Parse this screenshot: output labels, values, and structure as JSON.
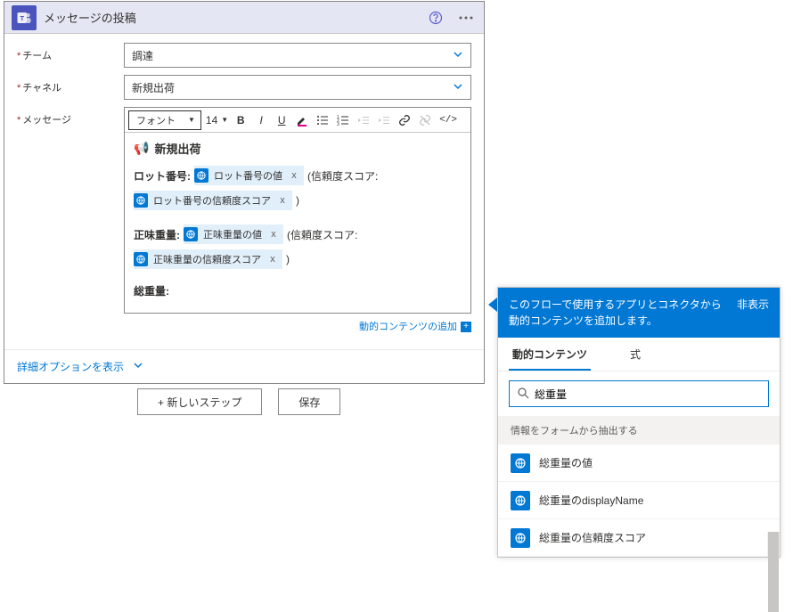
{
  "header": {
    "title": "メッセージの投稿"
  },
  "fields": {
    "team": {
      "label": "チーム",
      "value": "調達"
    },
    "channel": {
      "label": "チャネル",
      "value": "新規出荷"
    },
    "message": {
      "label": "メッセージ"
    }
  },
  "toolbar": {
    "font": "フォント",
    "size": "14"
  },
  "editor": {
    "announce_title": "新規出荷",
    "lot_label": "ロット番号:",
    "lot_token1": "ロット番号の値",
    "conf_prefix": "(信頼度スコア:",
    "lot_token2": "ロット番号の信頼度スコア",
    "close_paren": ")",
    "net_label": "正味重量:",
    "net_token1": "正味重量の値",
    "net_token2": "正味重量の信頼度スコア",
    "gross_label": "総重量:",
    "add_dynamic": "動的コンテンツの追加"
  },
  "token_x": "x",
  "advanced": "詳細オプションを表示",
  "buttons": {
    "new_step": "+ 新しいステップ",
    "save": "保存"
  },
  "flyout": {
    "desc": "このフローで使用するアプリとコネクタから動的コンテンツを追加します。",
    "hide": "非表示",
    "tab_dynamic": "動的コンテンツ",
    "tab_expr": "式",
    "search_value": "総重量",
    "group_title": "情報をフォームから抽出する",
    "items": {
      "i1": "総重量の値",
      "i2": "総重量のdisplayName",
      "i3": "総重量の信頼度スコア"
    }
  }
}
